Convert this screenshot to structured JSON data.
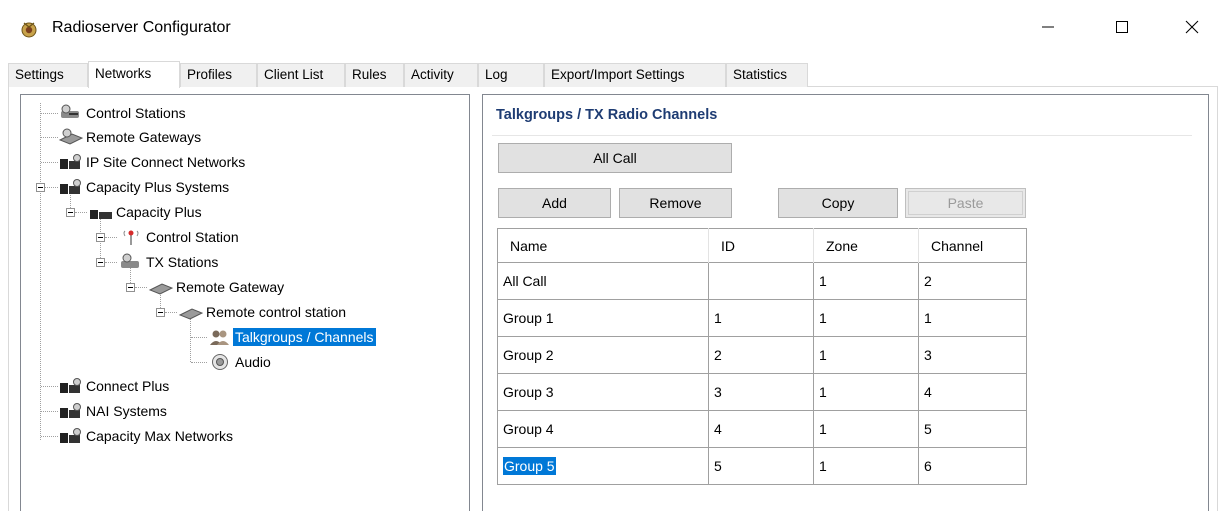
{
  "window": {
    "title": "Radioserver Configurator",
    "minimize_icon": "minimize-icon",
    "maximize_icon": "maximize-icon",
    "close_icon": "close-icon"
  },
  "tabs": [
    {
      "label": "Settings"
    },
    {
      "label": "Networks",
      "active": true
    },
    {
      "label": "Profiles"
    },
    {
      "label": "Client List"
    },
    {
      "label": "Rules"
    },
    {
      "label": "Activity"
    },
    {
      "label": "Log"
    },
    {
      "label": "Export/Import Settings"
    },
    {
      "label": "Statistics"
    }
  ],
  "tree": {
    "items": [
      {
        "label": "Control Stations",
        "icon": "control-stations-icon"
      },
      {
        "label": "Remote Gateways",
        "icon": "remote-gateways-icon"
      },
      {
        "label": "IP Site Connect Networks",
        "icon": "network-icon"
      },
      {
        "label": "Capacity Plus Systems",
        "icon": "network-icon",
        "expanded": true
      },
      {
        "label": "Capacity Plus",
        "icon": "system-icon",
        "expanded": true
      },
      {
        "label": "Control Station",
        "icon": "antenna-icon",
        "expanded": true
      },
      {
        "label": "TX Stations",
        "icon": "tx-stations-icon",
        "expanded": true
      },
      {
        "label": "Remote Gateway",
        "icon": "gateway-icon",
        "expanded": true
      },
      {
        "label": "Remote control station",
        "icon": "gateway-icon",
        "expanded": true
      },
      {
        "label": "Talkgroups / Channels",
        "icon": "talkgroups-icon",
        "selected": true
      },
      {
        "label": "Audio",
        "icon": "audio-icon"
      },
      {
        "label": "Connect Plus",
        "icon": "network-icon"
      },
      {
        "label": "NAI Systems",
        "icon": "network-icon"
      },
      {
        "label": "Capacity Max Networks",
        "icon": "network-icon"
      }
    ]
  },
  "panel": {
    "title": "Talkgroups / TX Radio Channels",
    "all_call_label": "All Call",
    "add_label": "Add",
    "remove_label": "Remove",
    "copy_label": "Copy",
    "paste_label": "Paste",
    "paste_enabled": false
  },
  "grid": {
    "headers": [
      "Name",
      "ID",
      "Zone",
      "Channel"
    ],
    "rows": [
      {
        "name": "All Call",
        "id": "",
        "zone": "1",
        "channel": "2"
      },
      {
        "name": "Group 1",
        "id": "1",
        "zone": "1",
        "channel": "1"
      },
      {
        "name": "Group 2",
        "id": "2",
        "zone": "1",
        "channel": "3"
      },
      {
        "name": "Group 3",
        "id": "3",
        "zone": "1",
        "channel": "4"
      },
      {
        "name": "Group 4",
        "id": "4",
        "zone": "1",
        "channel": "5"
      },
      {
        "name": "Group 5",
        "id": "5",
        "zone": "1",
        "channel": "6",
        "selected": true
      }
    ]
  },
  "colors": {
    "selection": "#0078d7",
    "panel_title": "#1e3c73"
  }
}
